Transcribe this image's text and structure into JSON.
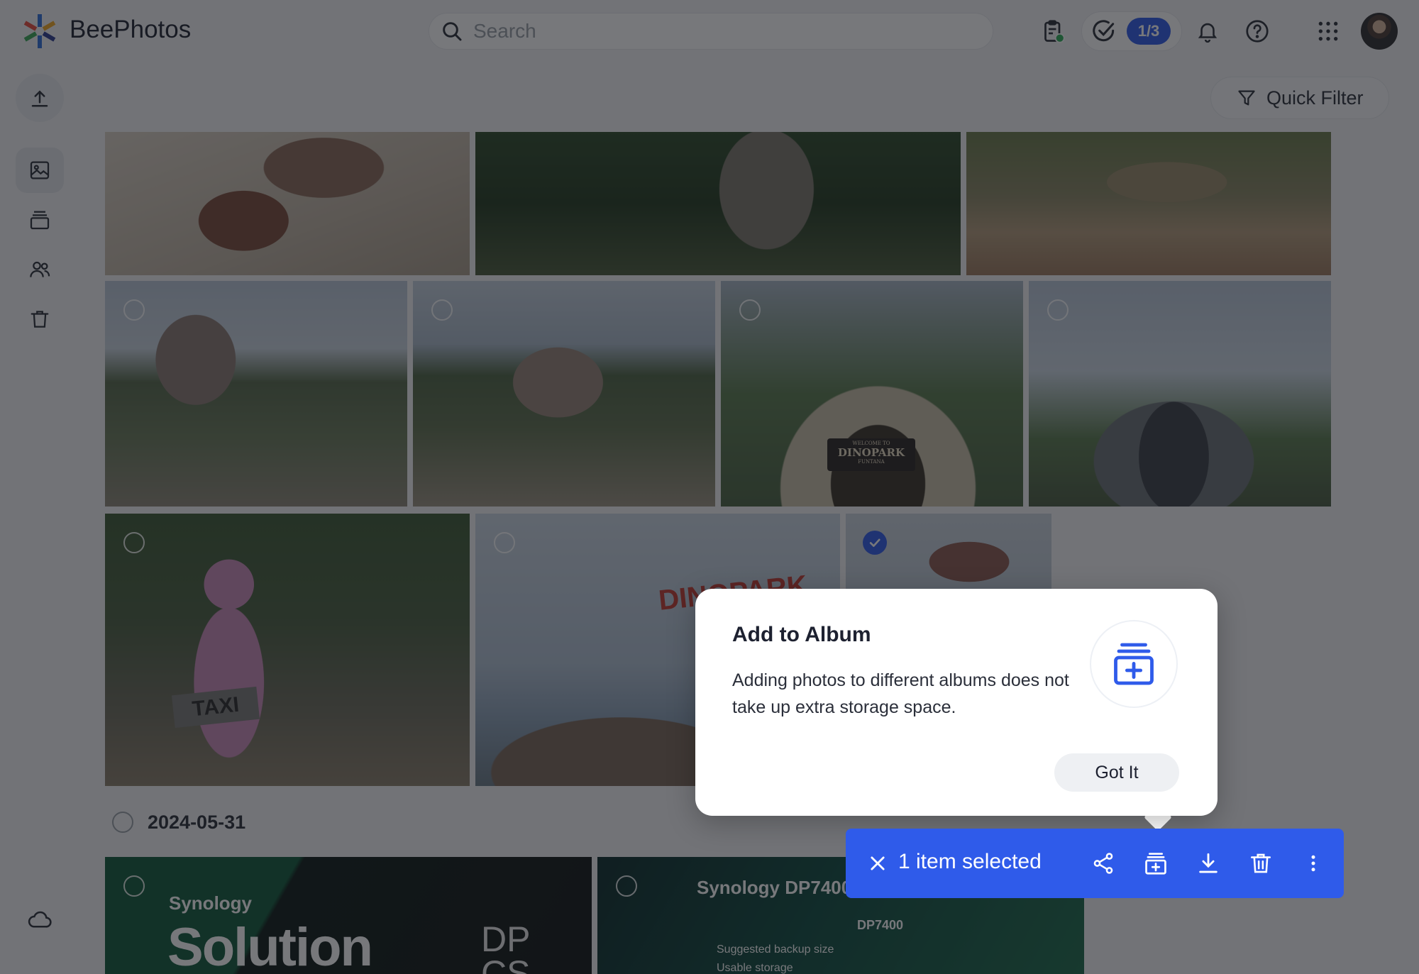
{
  "app": {
    "title": "BeePhotos"
  },
  "search": {
    "placeholder": "Search"
  },
  "header": {
    "task_badge": "1/3"
  },
  "toolbar": {
    "quick_filter_label": "Quick Filter"
  },
  "timeline": {
    "date_label": "2024-05-31"
  },
  "popover": {
    "title": "Add to Album",
    "description": "Adding photos to different albums does not take up extra storage space.",
    "button_label": "Got It"
  },
  "selection_bar": {
    "count_label": "1 item selected"
  },
  "photos": {
    "sign_dinopark": "DINOPARK",
    "sign_funtana": "FUNTANA",
    "sign_welcome": "WELCOME TO",
    "taxi": "TAXI",
    "dino_banner": "DINOPARK",
    "synology_brand": "Synology",
    "synology_solution": "Solution",
    "synology_dpcs": "DP CS",
    "dp7400_title": "Synology DP7400",
    "dp7400_model": "DP7400",
    "dp7400_backup": "Suggested backup size",
    "dp7400_usable": "Usable storage"
  },
  "colors": {
    "accent": "#2f5bea",
    "overlay": "rgba(20,22,28,0.58)"
  }
}
